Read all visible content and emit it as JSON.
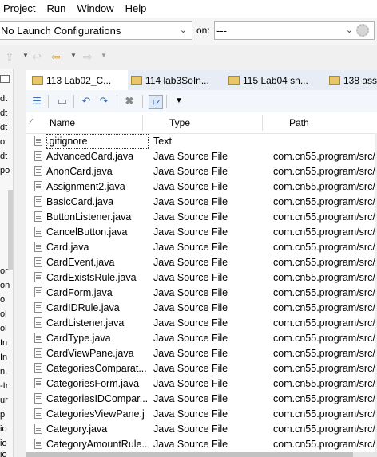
{
  "menu": [
    "Project",
    "Run",
    "Window",
    "Help"
  ],
  "launch": {
    "config_value": "No Launch Configurations",
    "on_label": "on:",
    "target_value": "---"
  },
  "left_fragments": [
    "dt",
    "dt",
    "dt",
    "o",
    "dt",
    "po",
    "or",
    "on",
    "o",
    "ol",
    "ol",
    "In",
    "In",
    "n.",
    "-Ir",
    "ur",
    "p",
    "io",
    "io",
    "io"
  ],
  "tabs": [
    "113 Lab02_C...",
    "114 lab3SoIn...",
    "115 Lab04 sn...",
    "138 ass3"
  ],
  "table": {
    "headers": [
      "Name",
      "Type",
      "Path"
    ],
    "rows": [
      {
        "name": ".gitignore",
        "type": "Text",
        "path": ""
      },
      {
        "name": "AdvancedCard.java",
        "type": "Java Source File",
        "path": "com.cn55.program/src/..."
      },
      {
        "name": "AnonCard.java",
        "type": "Java Source File",
        "path": "com.cn55.program/src/..."
      },
      {
        "name": "Assignment2.java",
        "type": "Java Source File",
        "path": "com.cn55.program/src/..."
      },
      {
        "name": "BasicCard.java",
        "type": "Java Source File",
        "path": "com.cn55.program/src/..."
      },
      {
        "name": "ButtonListener.java",
        "type": "Java Source File",
        "path": "com.cn55.program/src/..."
      },
      {
        "name": "CancelButton.java",
        "type": "Java Source File",
        "path": "com.cn55.program/src/..."
      },
      {
        "name": "Card.java",
        "type": "Java Source File",
        "path": "com.cn55.program/src/..."
      },
      {
        "name": "CardEvent.java",
        "type": "Java Source File",
        "path": "com.cn55.program/src/..."
      },
      {
        "name": "CardExistsRule.java",
        "type": "Java Source File",
        "path": "com.cn55.program/src/..."
      },
      {
        "name": "CardForm.java",
        "type": "Java Source File",
        "path": "com.cn55.program/src/..."
      },
      {
        "name": "CardIDRule.java",
        "type": "Java Source File",
        "path": "com.cn55.program/src/..."
      },
      {
        "name": "CardListener.java",
        "type": "Java Source File",
        "path": "com.cn55.program/src/..."
      },
      {
        "name": "CardType.java",
        "type": "Java Source File",
        "path": "com.cn55.program/src/..."
      },
      {
        "name": "CardViewPane.java",
        "type": "Java Source File",
        "path": "com.cn55.program/src/..."
      },
      {
        "name": "CategoriesComparat...",
        "type": "Java Source File",
        "path": "com.cn55.program/src/..."
      },
      {
        "name": "CategoriesForm.java",
        "type": "Java Source File",
        "path": "com.cn55.program/src/..."
      },
      {
        "name": "CategoriesIDCompar...",
        "type": "Java Source File",
        "path": "com.cn55.program/src/..."
      },
      {
        "name": "CategoriesViewPane.j",
        "type": "Java Source File",
        "path": "com.cn55.program/src/..."
      },
      {
        "name": "Category.java",
        "type": "Java Source File",
        "path": "com.cn55.program/src/..."
      },
      {
        "name": "CategoryAmountRule...",
        "type": "Java Source File",
        "path": "com.cn55.program/src/..."
      }
    ]
  }
}
